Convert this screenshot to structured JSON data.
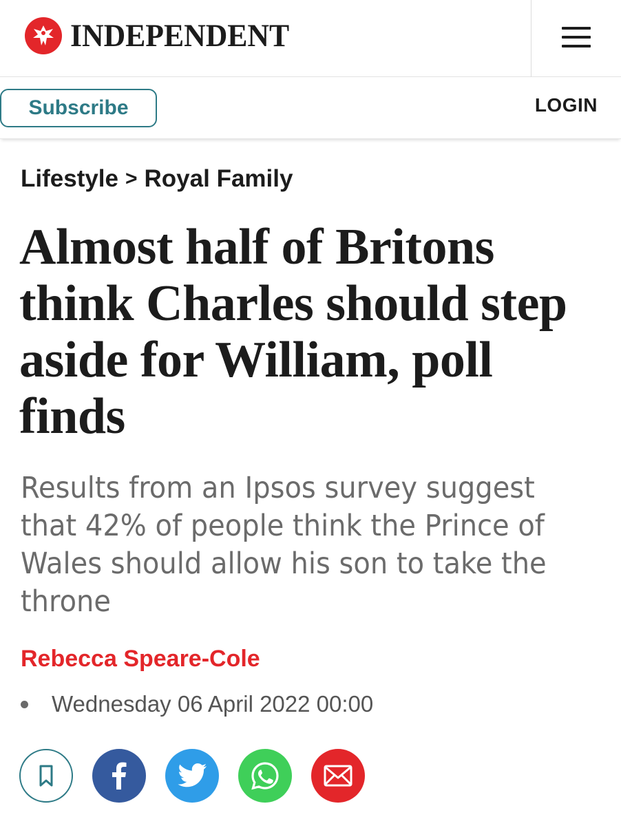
{
  "header": {
    "logo_text": "INDEPENDENT",
    "logo_icon": "eagle-icon",
    "menu_icon": "hamburger-menu-icon"
  },
  "subheader": {
    "subscribe_label": "Subscribe",
    "login_label": "LOGIN"
  },
  "breadcrumb": {
    "section": "Lifestyle",
    "separator": ">",
    "subsection": "Royal Family"
  },
  "article": {
    "headline": "Almost half of Britons think Charles should step aside for William, poll finds",
    "standfirst": "Results from an Ipsos survey suggest that 42% of people think the Prince of Wales should allow his son to take the throne",
    "author": "Rebecca Speare-Cole",
    "date": "Wednesday 06 April 2022 00:00"
  },
  "share": {
    "buttons": [
      {
        "name": "bookmark-icon",
        "color": "#2d7a86"
      },
      {
        "name": "facebook-icon",
        "color": "#355a9e"
      },
      {
        "name": "twitter-icon",
        "color": "#2f9de8"
      },
      {
        "name": "whatsapp-icon",
        "color": "#3fcf59"
      },
      {
        "name": "email-icon",
        "color": "#e3262a"
      }
    ]
  },
  "colors": {
    "brand_red": "#e3262a",
    "accent_teal": "#2d7a86",
    "text_dark": "#1c1c1c",
    "text_grey": "#6b6b6b"
  }
}
